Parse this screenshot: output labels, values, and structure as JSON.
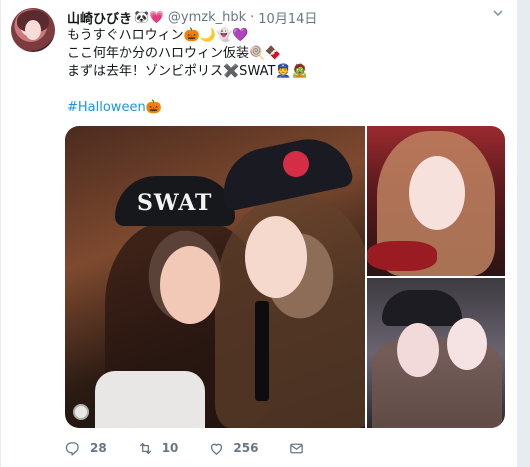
{
  "tweet": {
    "display_name": "山崎ひびき",
    "name_emoji": "🐼💗",
    "handle": "@ymzk_hbk",
    "separator": "·",
    "date": "10月14日",
    "text_lines": [
      "もうすぐハロウィン🎃🌙👻💜",
      "ここ何年か分のハロウィン仮装🍭🍫",
      "まずは去年！ゾンビポリス✖️SWAT👮🧟"
    ],
    "hashtag": "#Halloween🎃",
    "media": {
      "photos": [
        {
          "name": "main-photo",
          "cap_text": "SWAT"
        },
        {
          "name": "top-right-photo"
        },
        {
          "name": "bottom-right-photo"
        }
      ]
    },
    "actions": {
      "reply_count": "28",
      "retweet_count": "10",
      "like_count": "256"
    }
  },
  "icons": [
    "chevron-down-icon",
    "reply-icon",
    "retweet-icon",
    "like-icon",
    "message-icon",
    "gif-indicator-icon"
  ],
  "colors": {
    "text": "#14171a",
    "muted": "#657786",
    "link": "#1b95e0",
    "background": "#e6ecf0",
    "card": "#ffffff"
  }
}
